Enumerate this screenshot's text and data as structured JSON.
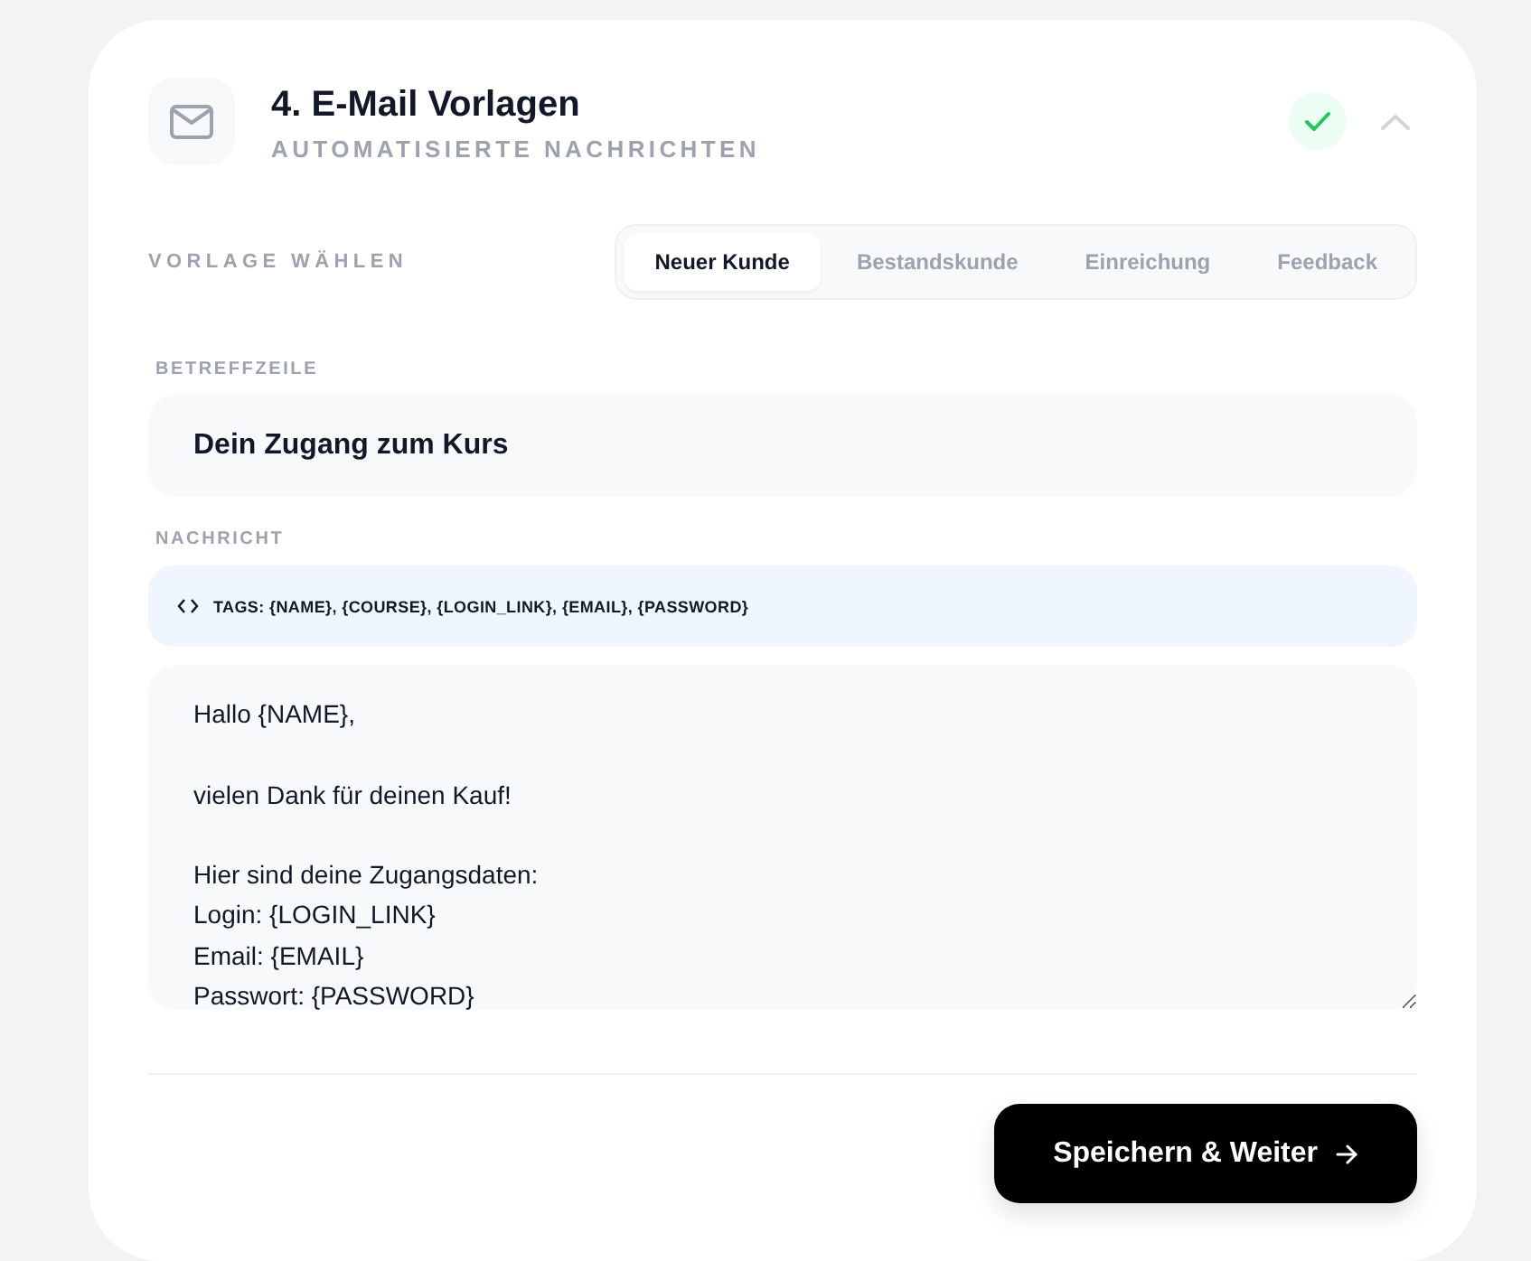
{
  "section": {
    "title": "4. E-Mail Vorlagen",
    "subtitle": "AUTOMATISIERTE NACHRICHTEN",
    "completed": true,
    "expanded": true
  },
  "template_picker": {
    "label": "VORLAGE WÄHLEN",
    "tabs": [
      {
        "label": "Neuer Kunde",
        "selected": true
      },
      {
        "label": "Bestandskunde",
        "selected": false
      },
      {
        "label": "Einreichung",
        "selected": false
      },
      {
        "label": "Feedback",
        "selected": false
      }
    ]
  },
  "subject": {
    "label": "BETREFFZEILE",
    "value": "Dein Zugang zum Kurs"
  },
  "message": {
    "label": "NACHRICHT",
    "tags_hint": "TAGS: {NAME}, {COURSE}, {LOGIN_LINK}, {EMAIL}, {PASSWORD}",
    "value": "Hallo {NAME},\n\nvielen Dank für deinen Kauf!\n\nHier sind deine Zugangsdaten:\nLogin: {LOGIN_LINK}\nEmail: {EMAIL}\nPasswort: {PASSWORD}"
  },
  "primary_button": {
    "label": "Speichern & Weiter"
  }
}
